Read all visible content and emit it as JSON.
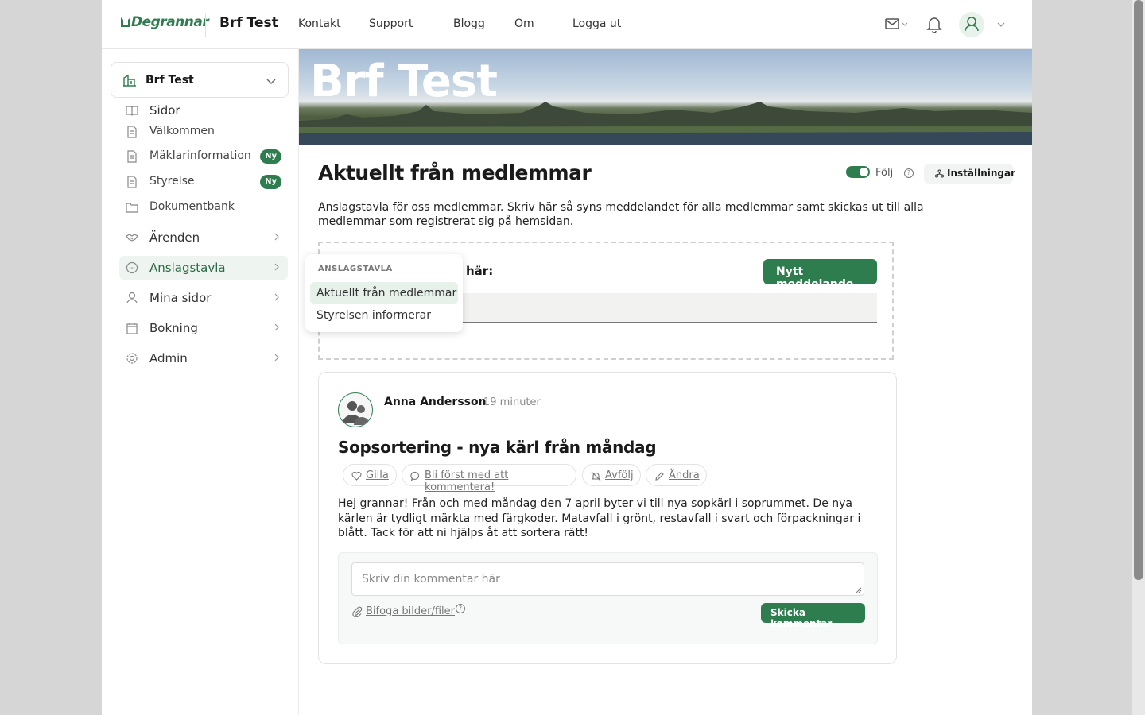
{
  "header": {
    "logo": "Degrannar",
    "site_name": "Brf Test",
    "nav": [
      "Kontakt",
      "Support",
      "Blogg",
      "Om",
      "Logga ut"
    ]
  },
  "sidebar": {
    "org": "Brf Test",
    "items": [
      {
        "label": "Sidor",
        "icon": "book-icon"
      },
      {
        "label": "Välkommen",
        "icon": "page-icon"
      },
      {
        "label": "Mäklarinformation",
        "icon": "page-icon",
        "badge": "Ny"
      },
      {
        "label": "Styrelse",
        "icon": "page-icon",
        "badge": "Ny"
      },
      {
        "label": "Dokumentbank",
        "icon": "folder-icon"
      },
      {
        "label": "Ärenden",
        "icon": "handshake-icon"
      },
      {
        "label": "Anslagstavla",
        "icon": "chat-icon"
      },
      {
        "label": "Mina sidor",
        "icon": "user-icon"
      },
      {
        "label": "Bokning",
        "icon": "calendar-icon"
      },
      {
        "label": "Admin",
        "icon": "gear-icon"
      }
    ]
  },
  "flyout": {
    "heading": "ANSLAGSTAVLA",
    "items": [
      "Aktuellt från medlemmar",
      "Styrelsen informerar"
    ]
  },
  "banner": {
    "title": "Brf Test"
  },
  "main": {
    "title": "Aktuellt från medlemmar",
    "follow_label": "Följ",
    "settings_label": "Inställningar",
    "intro": "Anslagstavla för oss medlemmar. Skriv här så syns meddelandet för alla medlemmar samt skickas ut till alla medlemmar som registrerat sig på hemsidan.",
    "new_box_question": "här:",
    "new_message_button": "Nytt meddelande"
  },
  "post": {
    "author": "Anna Andersson",
    "time": "19 minuter",
    "title": "Sopsortering - nya kärl från måndag",
    "actions": [
      "Gilla",
      "Bli först med att kommentera!",
      "Avfölj",
      "Ändra"
    ],
    "body": "Hej grannar! Från och med måndag den 7 april byter vi till nya sopkärl i soprummet. De nya kärlen är tydligt märkta med färgkoder. Matavfall i grönt, restavfall i svart och förpackningar i blått. Tack för att ni hjälps åt att sortera rätt!",
    "comment_placeholder": "Skriv din kommentar här",
    "attach_label": "Bifoga bilder/filer",
    "send_label": "Skicka kommentar"
  },
  "colors": {
    "brand": "#2e7d4f",
    "badge": "#2e7d4f"
  }
}
